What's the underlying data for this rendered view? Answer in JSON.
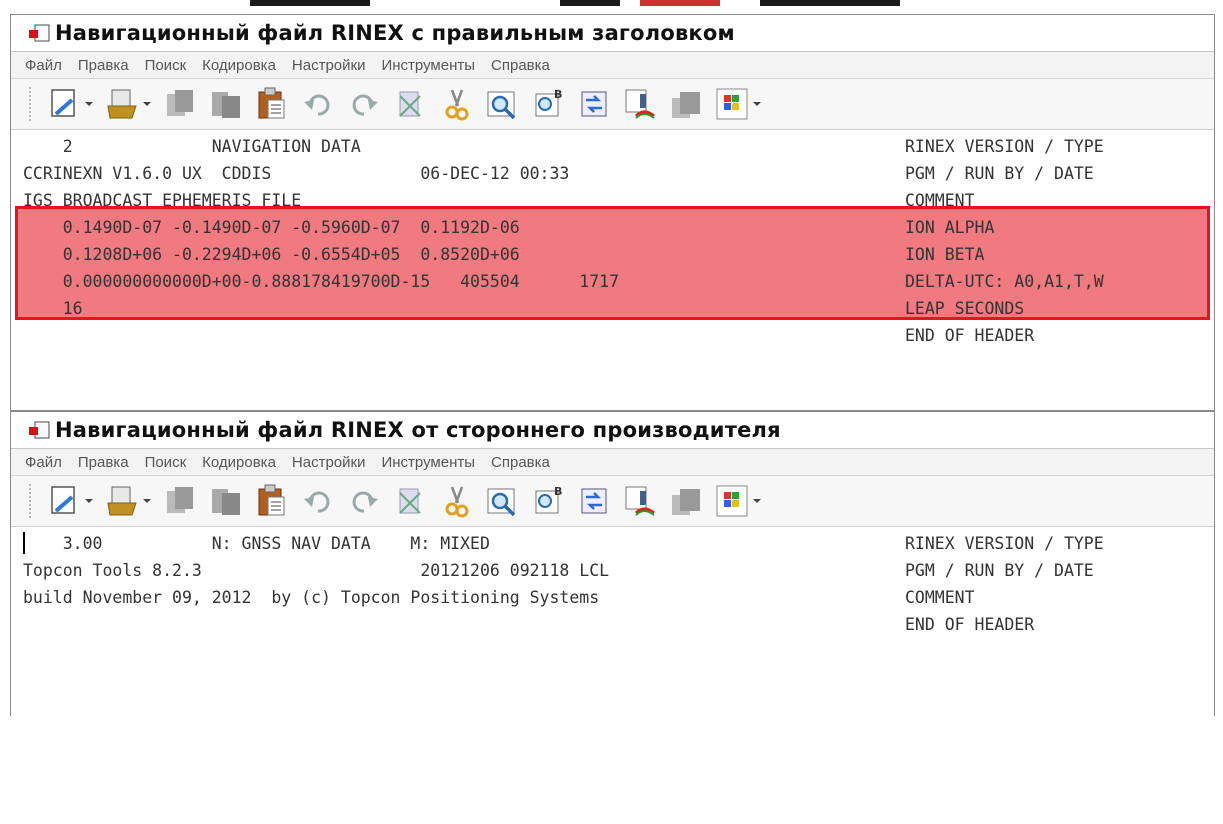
{
  "window1": {
    "title": "Навигационный файл RINEX с правильным заголовком",
    "menu": [
      "Файл",
      "Правка",
      "Поиск",
      "Кодировка",
      "Настройки",
      "Инструменты",
      "Справка"
    ],
    "toolbar_icons": [
      "new-document-icon",
      "open-folder-icon",
      "copy-icon",
      "paste-disabled-icon",
      "clipboard-icon",
      "undo-icon",
      "redo-icon",
      "delete-icon",
      "cut-icon",
      "find-icon",
      "find-replace-icon",
      "goto-icon",
      "color-brush-icon",
      "disabled-tool-icon",
      "windows-icon"
    ],
    "lines": [
      {
        "text": "    2              NAVIGATION DATA",
        "label": "RINEX VERSION / TYPE"
      },
      {
        "text": "CCRINEXN V1.6.0 UX  CDDIS               06-DEC-12 00:33",
        "label": "PGM / RUN BY / DATE"
      },
      {
        "text": "IGS BROADCAST EPHEMERIS FILE",
        "label": "COMMENT"
      },
      {
        "text": "    0.1490D-07 -0.1490D-07 -0.5960D-07  0.1192D-06",
        "label": "ION ALPHA"
      },
      {
        "text": "    0.1208D+06 -0.2294D+06 -0.6554D+05  0.8520D+06",
        "label": "ION BETA"
      },
      {
        "text": "    0.000000000000D+00-0.888178419700D-15   405504      1717",
        "label": "DELTA-UTC: A0,A1,T,W"
      },
      {
        "text": "    16",
        "label": "LEAP SECONDS"
      },
      {
        "text": "",
        "label": "END OF HEADER"
      }
    ]
  },
  "window2": {
    "title": "Навигационный файл RINEX от стороннего производителя",
    "menu": [
      "Файл",
      "Правка",
      "Поиск",
      "Кодировка",
      "Настройки",
      "Инструменты",
      "Справка"
    ],
    "lines": [
      {
        "text": "    3.00           N: GNSS NAV DATA    M: MIXED",
        "label": "RINEX VERSION / TYPE"
      },
      {
        "text": "Topcon Tools 8.2.3                      20121206 092118 LCL",
        "label": "PGM / RUN BY / DATE"
      },
      {
        "text": "build November 09, 2012  by (c) Topcon Positioning Systems",
        "label": "COMMENT"
      },
      {
        "text": "",
        "label": "END OF HEADER"
      }
    ]
  },
  "colors": {
    "highlight_fill": "#f07a80",
    "highlight_border": "#e01818",
    "text": "#333333"
  }
}
